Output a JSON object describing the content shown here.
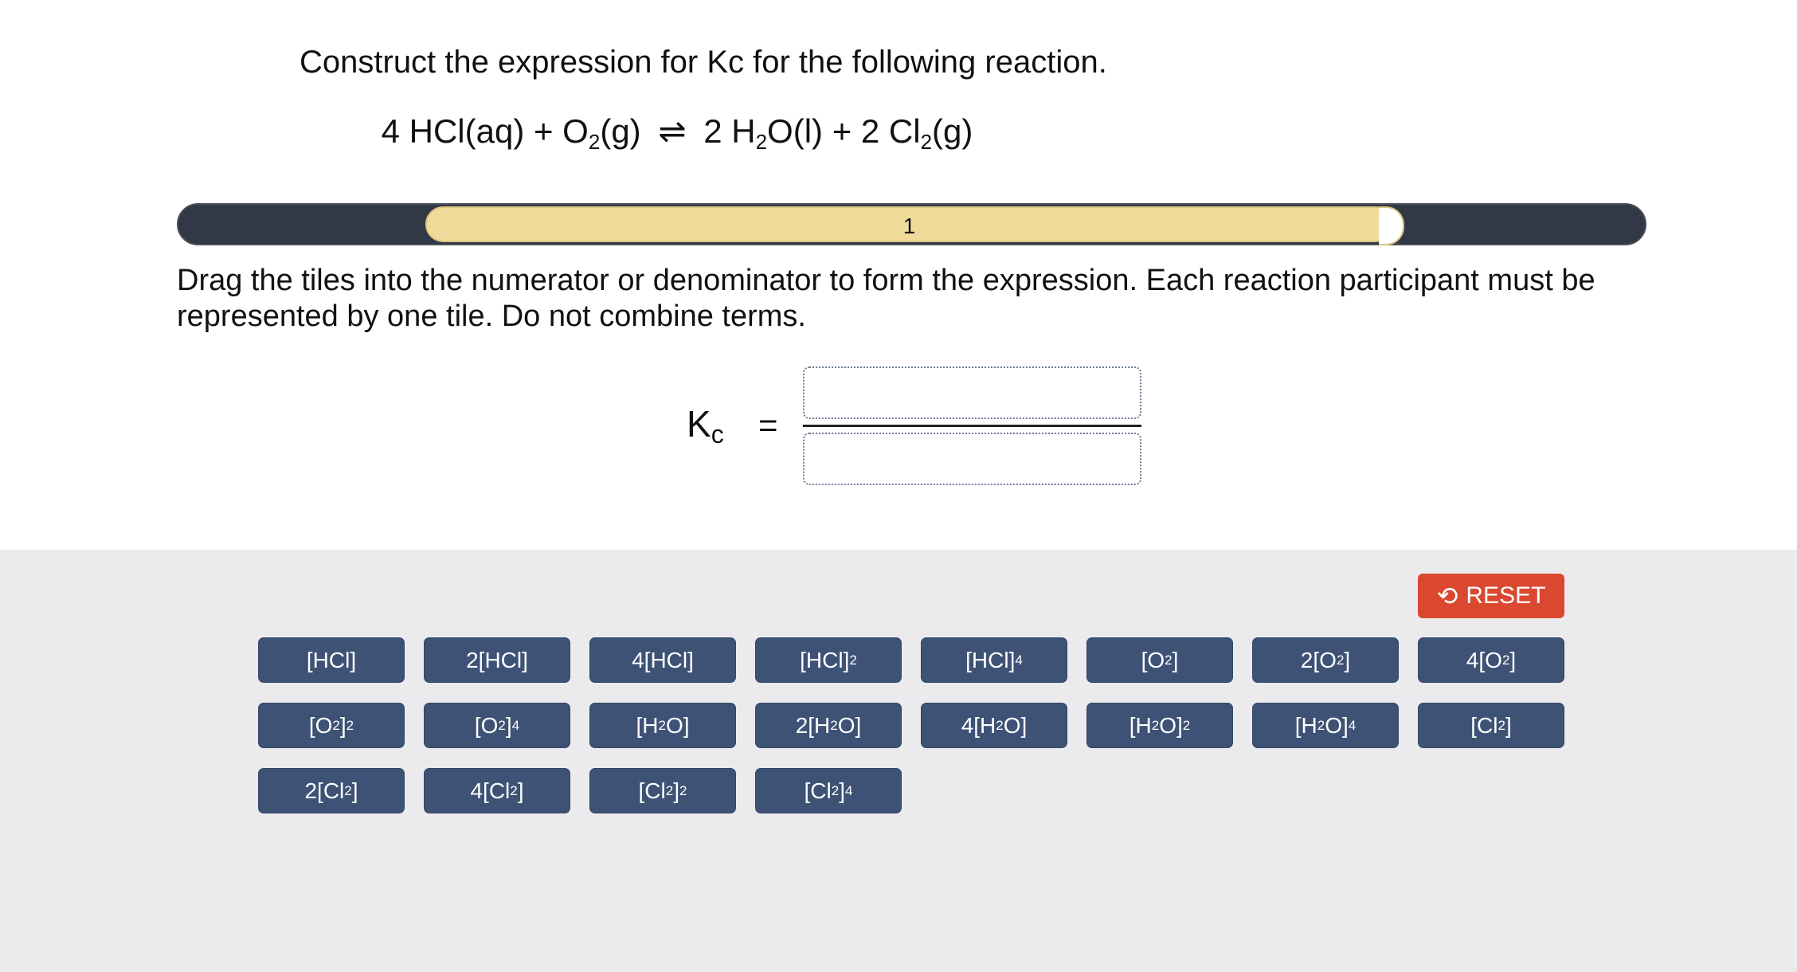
{
  "question": "Construct the expression for Kc for the following reaction.",
  "equation": {
    "p1": "4 HCl(aq) + O",
    "s1": "2",
    "p2": "(g)",
    "arrow": "⇌",
    "p3": "2 H",
    "s2": "2",
    "p4": "O(l) + 2 Cl",
    "s3": "2",
    "p5": "(g)"
  },
  "progress": {
    "label": "1",
    "fill_fraction": 0.66
  },
  "instructions": "Drag the tiles into the numerator or denominator to form the expression. Each reaction participant must be represented by one tile. Do not combine terms.",
  "kc": {
    "K": "K",
    "c": "c",
    "equals": "="
  },
  "reset": {
    "label": "RESET",
    "icon": "reset-icon"
  },
  "tiles": [
    {
      "a": "[HCl]",
      "sub": "",
      "b": "",
      "sup": ""
    },
    {
      "a": "2[HCl]",
      "sub": "",
      "b": "",
      "sup": ""
    },
    {
      "a": "4[HCl]",
      "sub": "",
      "b": "",
      "sup": ""
    },
    {
      "a": "[HCl]",
      "sub": "",
      "b": "",
      "sup": "2"
    },
    {
      "a": "[HCl]",
      "sub": "",
      "b": "",
      "sup": "4"
    },
    {
      "a": "[O",
      "sub": "2",
      "b": "]",
      "sup": ""
    },
    {
      "a": "2[O",
      "sub": "2",
      "b": "]",
      "sup": ""
    },
    {
      "a": "4[O",
      "sub": "2",
      "b": "]",
      "sup": ""
    },
    {
      "a": "[O",
      "sub": "2",
      "b": "]",
      "sup": "2"
    },
    {
      "a": "[O",
      "sub": "2",
      "b": "]",
      "sup": "4"
    },
    {
      "a": "[H",
      "sub": "2",
      "b": "O]",
      "sup": ""
    },
    {
      "a": "2[H",
      "sub": "2",
      "b": "O]",
      "sup": ""
    },
    {
      "a": "4[H",
      "sub": "2",
      "b": "O]",
      "sup": ""
    },
    {
      "a": "[H",
      "sub": "2",
      "b": "O]",
      "sup": "2"
    },
    {
      "a": "[H",
      "sub": "2",
      "b": "O]",
      "sup": "4"
    },
    {
      "a": "[Cl",
      "sub": "2",
      "b": "]",
      "sup": ""
    },
    {
      "a": "2[Cl",
      "sub": "2",
      "b": "]",
      "sup": ""
    },
    {
      "a": "4[Cl",
      "sub": "2",
      "b": "]",
      "sup": ""
    },
    {
      "a": "[Cl",
      "sub": "2",
      "b": "]",
      "sup": "2"
    },
    {
      "a": "[Cl",
      "sub": "2",
      "b": "]",
      "sup": "4"
    }
  ]
}
